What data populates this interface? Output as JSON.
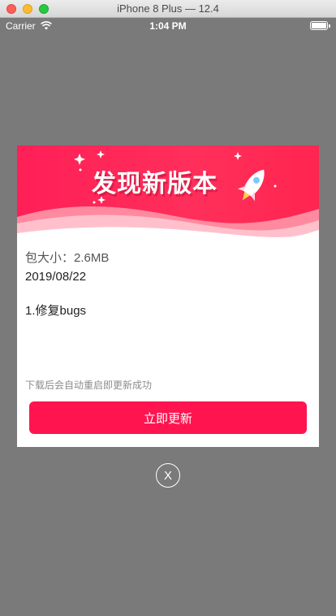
{
  "window": {
    "title": "iPhone 8 Plus — 12.4"
  },
  "status_bar": {
    "carrier": "Carrier",
    "time": "1:04 PM"
  },
  "dialog": {
    "banner_title": "发现新版本",
    "package_size": "包大小：2.6MB",
    "date": "2019/08/22",
    "release_notes": "1.修复bugs",
    "hint": "下载后会自动重启即更新成功",
    "update_button_label": "立即更新",
    "close_label": "X"
  },
  "colors": {
    "accent": "#ff1450",
    "banner": "#ff2f5a",
    "overlay": "#7a7a7a"
  },
  "icons": [
    "wifi-icon",
    "battery-icon",
    "rocket-icon",
    "sparkle-icon",
    "close-icon"
  ]
}
